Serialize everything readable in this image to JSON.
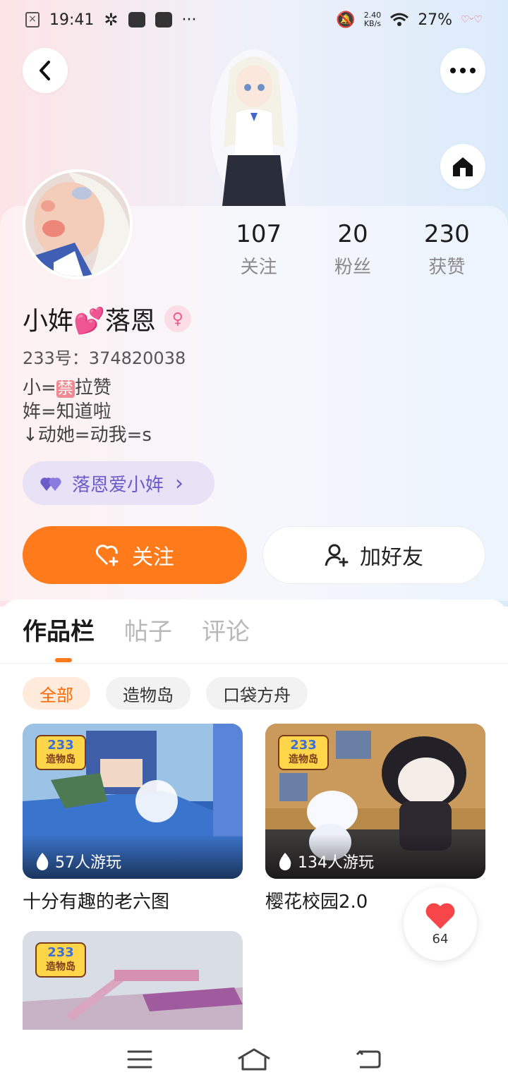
{
  "status_bar": {
    "time": "19:41",
    "net_speed_top": "2.40",
    "net_speed_bottom": "KB/s",
    "battery": "27%"
  },
  "stats": [
    {
      "value": "107",
      "label": "关注"
    },
    {
      "value": "20",
      "label": "粉丝"
    },
    {
      "value": "230",
      "label": "获赞"
    }
  ],
  "profile": {
    "name_part1": "小姩",
    "name_emoji": "💕",
    "name_part2": "落恩",
    "gender_symbol": "♀",
    "uid": "233号：374820038",
    "bio_line1_a": "小=",
    "bio_line1_ban": "禁",
    "bio_line1_b": "拉赞",
    "bio_line2": "姩=知道啦",
    "bio_line3": "↓动她=动我=s"
  },
  "cp_pill": {
    "label": "落恩爱小姩",
    "arrow": "›"
  },
  "actions": {
    "follow": "关注",
    "add_friend": "加好友"
  },
  "tabs": [
    "作品栏",
    "帖子",
    "评论"
  ],
  "chips": [
    "全部",
    "造物岛",
    "口袋方舟"
  ],
  "badge": {
    "top": "233",
    "bottom": "造物岛"
  },
  "cards": [
    {
      "plays": "57人游玩",
      "title": "十分有趣的老六图"
    },
    {
      "plays": "134人游玩",
      "title": "樱花校园2.0"
    },
    {
      "plays": "",
      "title": ""
    }
  ],
  "like_fab": {
    "count": "64"
  },
  "colors": {
    "accent": "#ff7a1a",
    "cp_purple": "#6b5bc9",
    "like_red": "#f7464a"
  },
  "icons": [
    "back-icon",
    "more-icon",
    "home-icon",
    "heart-plus-icon",
    "person-add-icon",
    "flame-icon",
    "heart-icon",
    "menu-icon",
    "nav-home-icon",
    "nav-back-icon"
  ]
}
